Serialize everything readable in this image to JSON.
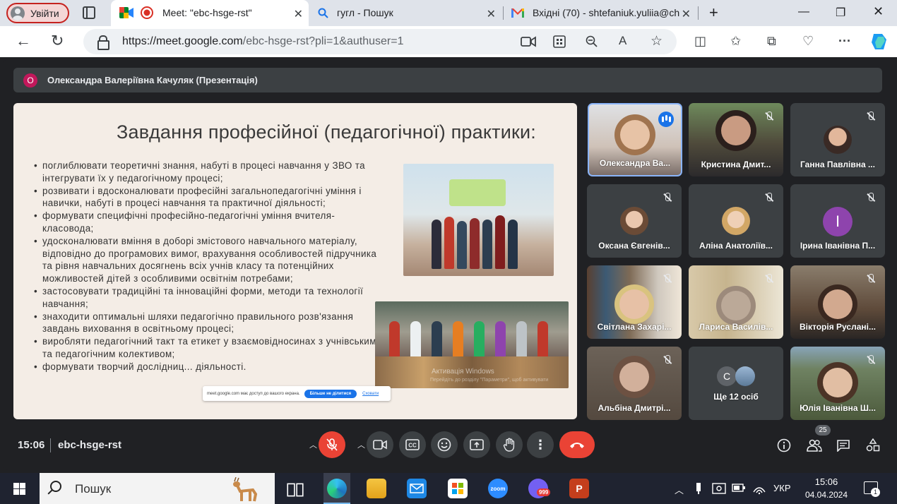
{
  "browser": {
    "profile_label": "Увійти",
    "tabs": [
      {
        "title": "Meet: \"ebc-hsge-rst\"",
        "active": true
      },
      {
        "title": "гугл - Пошук",
        "active": false
      },
      {
        "title": "Вхідні (70) - shtefaniuk.yuliia@ch",
        "active": false
      }
    ],
    "url_host": "https://meet.google.com",
    "url_path": "/ebc-hsge-rst?pli=1&authuser=1"
  },
  "meet": {
    "presenter_initial": "O",
    "presenter_label": "Олександра Валеріївна Качуляк (Презентація)",
    "slide": {
      "title": "Завдання професійної (педагогічної) практики:",
      "bullets": [
        "поглиблювати теоретичні знання, набуті в процесі навчання у ЗВО та інтегрувати їх у педагогічному процесі;",
        "розвивати і вдосконалювати професійні загальнопедагогічні уміння і навички, набуті в процесі навчання та практичної діяльності;",
        "формувати специфічні професійно-педагогічні уміння вчителя-класовода;",
        "удосконалювати вміння в доборі змістового навчального матеріалу, відповідно до програмових вимог, врахування особливостей підручника та рівня навчальних досягнень всіх учнів класу та потенційних можливостей дітей з особливими освітнім потребами;",
        "застосовувати традиційні та інноваційні форми, методи та технології навчання;",
        "знаходити оптимальні шляхи педагогічно правильного розв'язання завдань виховання в освітньому процесі;",
        "виробляти педагогічний такт та етикет у взаємовідносинах з учнівським та педагогічним колективом;",
        "формувати творчий дослідниц... діяльності."
      ],
      "watermark": "Активація Windows",
      "watermark_sub": "Перейдіть до розділу \"Параметри\", щоб активувати",
      "share_notice": "meet.google.com має доступ до вашого екрана.",
      "share_stop": "Більше не ділитися",
      "share_hide": "Сховати"
    },
    "participants": [
      {
        "name": "Олександра Ва...",
        "speaking": true
      },
      {
        "name": "Кристина Дмит...",
        "muted": true
      },
      {
        "name": "Ганна Павлівна ...",
        "muted": true
      },
      {
        "name": "Оксана Євгенів...",
        "muted": true
      },
      {
        "name": "Аліна Анатоліїв...",
        "muted": true
      },
      {
        "name": "Ірина Іванівна П...",
        "muted": true,
        "initial": "І"
      },
      {
        "name": "Світлана Захарі...",
        "muted": true
      },
      {
        "name": "Лариса Василів...",
        "muted": true
      },
      {
        "name": "Вікторія Руслані...",
        "muted": true
      },
      {
        "name": "Альбіна Дмитрі...",
        "muted": true
      },
      {
        "name": "Ще 12 осіб",
        "initial": "С"
      },
      {
        "name": "Юлія Іванівна Ш...",
        "muted": true
      }
    ],
    "time": "15:06",
    "meeting_code": "ebc-hsge-rst",
    "participant_count": "25"
  },
  "taskbar": {
    "search_placeholder": "Пошук",
    "language": "УКР",
    "time": "15:06",
    "date": "04.04.2024",
    "zoom_label": "zoom",
    "viber_badge": "999",
    "ppt_label": "P",
    "notification_count": "1"
  }
}
